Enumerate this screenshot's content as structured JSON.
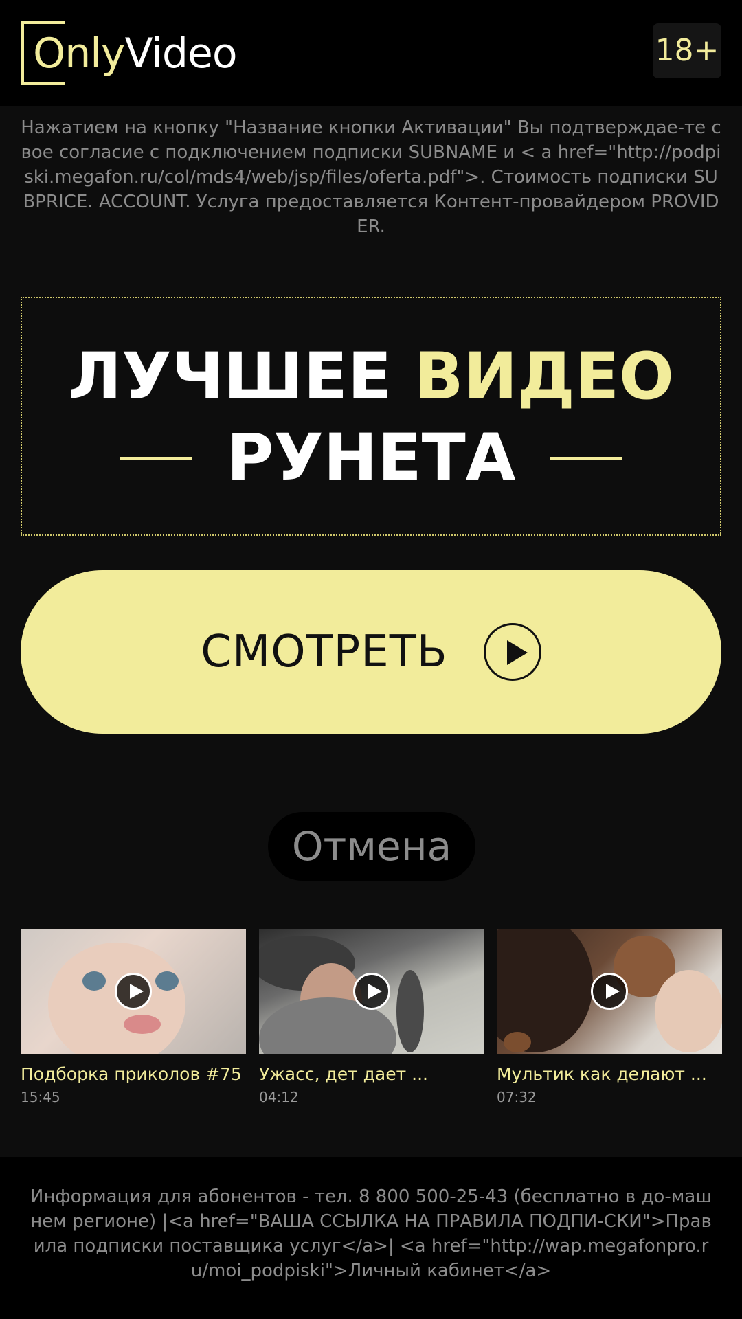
{
  "header": {
    "logo_only": "Only",
    "logo_video": "Video",
    "age_badge": "18+"
  },
  "disclaimer": "Нажатием на кнопку \"Название кнопки Активации\" Вы подтверждае-те свое согласие с подключением подписки SUBNAME и < a href=\"http://podpiski.megafon.ru/col/mds4/web/jsp/files/oferta.pdf\">. Стоимость подписки SUBPRICE. ACCOUNT. Услуга предоставляется Контент-провайдером PROVIDER.",
  "promo": {
    "line1_white": "ЛУЧШЕЕ",
    "line1_accent": "ВИДЕО",
    "line2": "РУНЕТА"
  },
  "actions": {
    "watch_label": "СМОТРЕТЬ",
    "cancel_label": "Отмена"
  },
  "videos": [
    {
      "title": "Подборка приколов #75",
      "duration": "15:45"
    },
    {
      "title": "Ужасс, дет дает ...",
      "duration": "04:12"
    },
    {
      "title": "Мультик как делают ...",
      "duration": "07:32"
    }
  ],
  "footer": {
    "text": "Информация для абонентов - тел. 8 800 500-25-43 (бесплатно в до-машнем регионе) |<a href=\"ВАША ССЫЛКА НА ПРАВИЛА ПОДПИ-СКИ\">Правила подписки поставщика услуг</a>| <a href=\"http://wap.megafonpro.ru/moi_podpiski\">Личный кабинет</a>"
  },
  "colors": {
    "accent": "#f2ec9b",
    "background": "#0d0d0d",
    "header_bg": "#000000",
    "muted_text": "#8c8c8c"
  },
  "icons": [
    "play-icon",
    "video-play-icon"
  ]
}
